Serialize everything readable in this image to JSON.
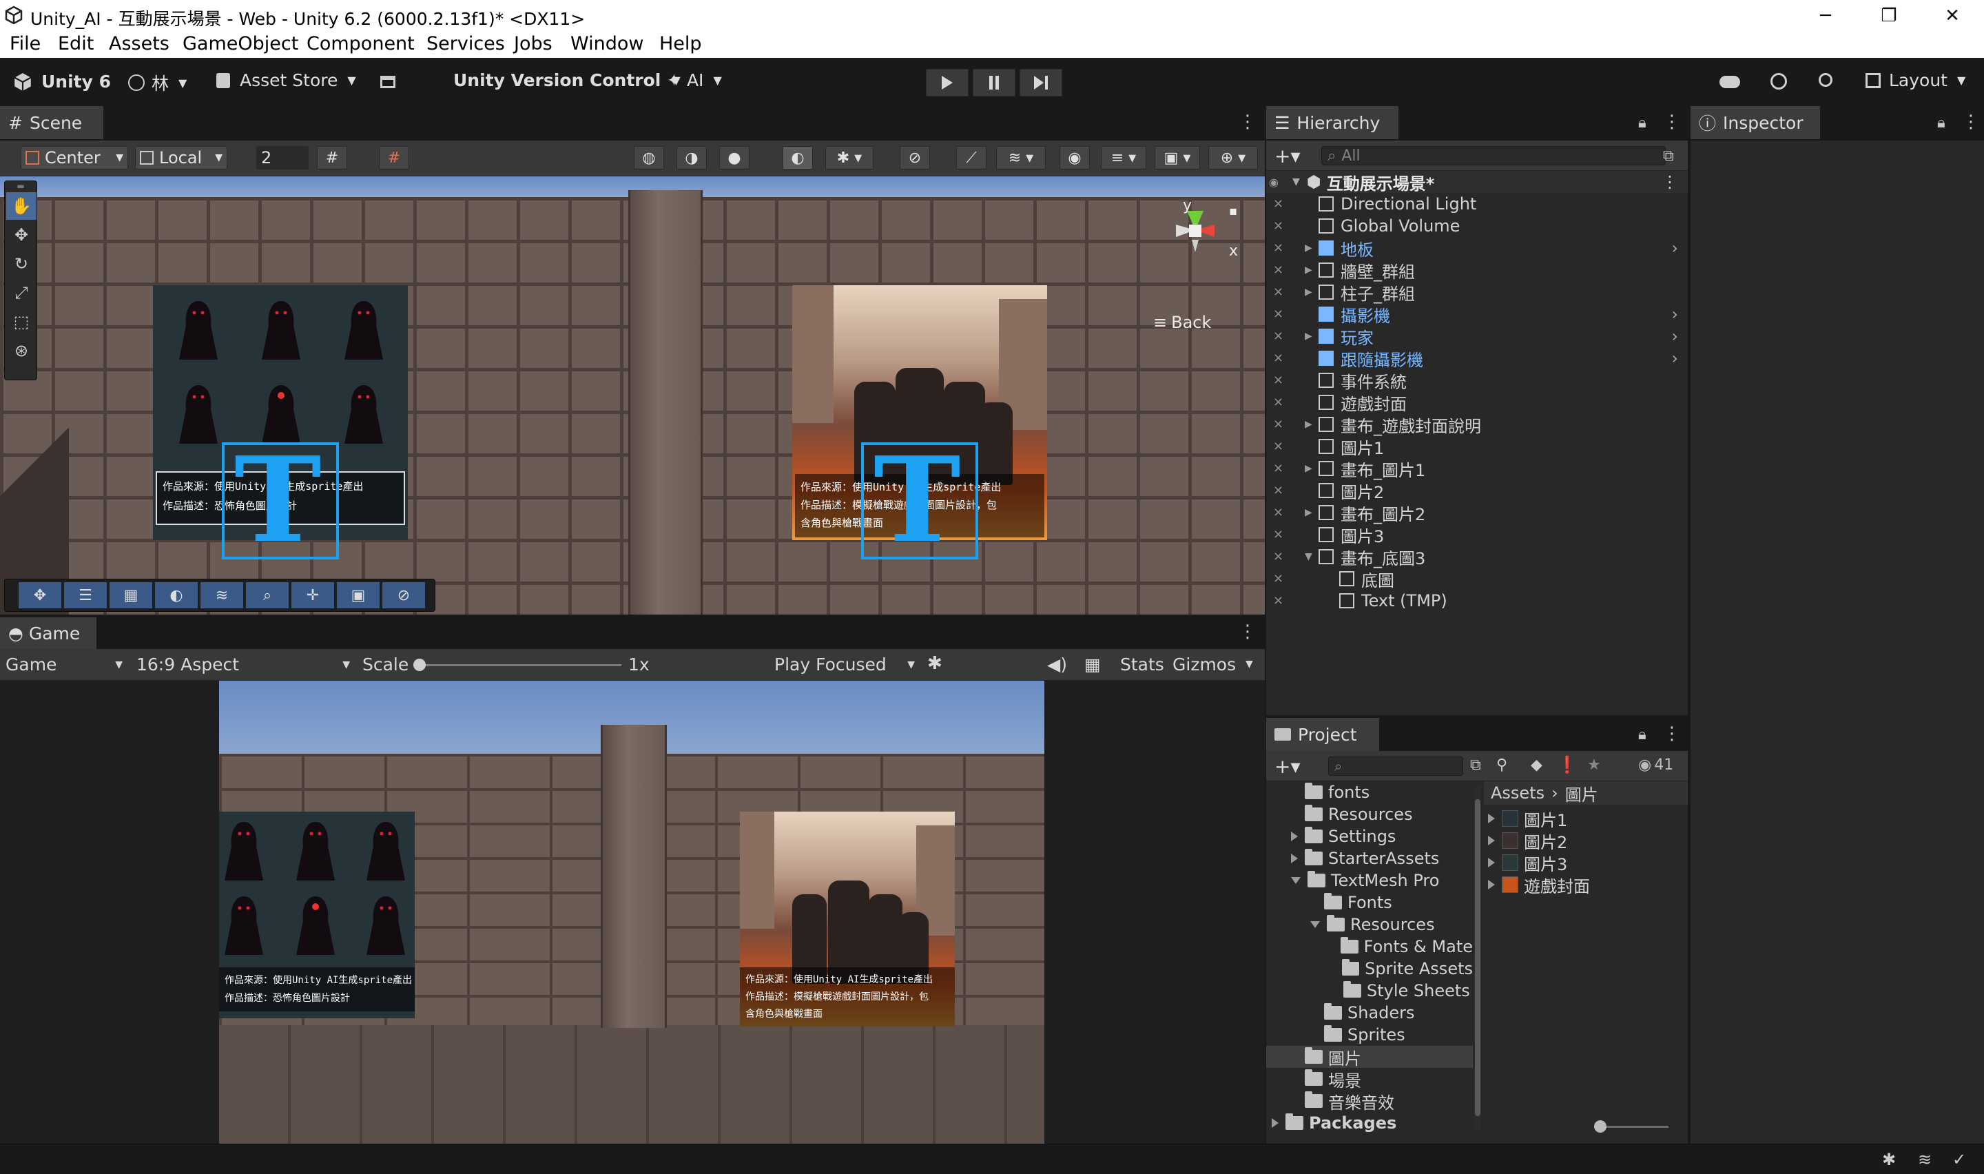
{
  "window": {
    "title": "Unity_AI - 互動展示場景 - Web - Unity 6.2 (6000.2.13f1)* <DX11>",
    "controls": [
      "─",
      "❐",
      "✕"
    ]
  },
  "menu": [
    "File",
    "Edit",
    "Assets",
    "GameObject",
    "Component",
    "Services",
    "Jobs",
    "Window",
    "Help"
  ],
  "toolbar": {
    "unity_label": "Unity 6",
    "account_label": "林",
    "asset_store_label": "Asset Store",
    "vcs_label": "Unity Version Control",
    "ai_label": "AI",
    "layout_label": "Layout"
  },
  "scene": {
    "tab_label": "Scene",
    "pivot_label": "Center",
    "space_label": "Local",
    "grid_value": "2",
    "gizmo_y": "y",
    "gizmo_x": "x",
    "gizmo_back": "Back"
  },
  "game": {
    "tab_label": "Game",
    "display_label": "Game",
    "aspect_label": "16:9 Aspect",
    "scale_label": "Scale",
    "scale_value": "1x",
    "play_mode_label": "Play Focused",
    "stats_label": "Stats",
    "gizmos_label": "Gizmos"
  },
  "cards": {
    "left_line1": "作品來源：使用Unity AI生成sprite產出",
    "left_line2": "作品描述：恐怖角色圖片設計",
    "right_line1": "作品來源：使用Unity AI生成sprite產出",
    "right_line2": "作品描述：模擬槍戰遊戲封面圖片設計，包",
    "right_line3": "含角色與槍戰畫面",
    "t_glyph": "T"
  },
  "hierarchy": {
    "tab_label": "Hierarchy",
    "search_placeholder": "All",
    "scene_name": "互動展示場景*",
    "items": [
      {
        "label": "Directional Light",
        "indent": 1,
        "arrow": "",
        "prefab": false
      },
      {
        "label": "Global Volume",
        "indent": 1,
        "arrow": "",
        "prefab": false
      },
      {
        "label": "地板",
        "indent": 1,
        "arrow": "right",
        "prefab": true
      },
      {
        "label": "牆壁_群組",
        "indent": 1,
        "arrow": "right",
        "prefab": false
      },
      {
        "label": "柱子_群組",
        "indent": 1,
        "arrow": "right",
        "prefab": false
      },
      {
        "label": "攝影機",
        "indent": 1,
        "arrow": "",
        "prefab": true
      },
      {
        "label": "玩家",
        "indent": 1,
        "arrow": "right",
        "prefab": true
      },
      {
        "label": "跟隨攝影機",
        "indent": 1,
        "arrow": "",
        "prefab": true
      },
      {
        "label": "事件系統",
        "indent": 1,
        "arrow": "",
        "prefab": false
      },
      {
        "label": "遊戲封面",
        "indent": 1,
        "arrow": "",
        "prefab": false
      },
      {
        "label": "畫布_遊戲封面說明",
        "indent": 1,
        "arrow": "right",
        "prefab": false
      },
      {
        "label": "圖片1",
        "indent": 1,
        "arrow": "",
        "prefab": false
      },
      {
        "label": "畫布_圖片1",
        "indent": 1,
        "arrow": "right",
        "prefab": false
      },
      {
        "label": "圖片2",
        "indent": 1,
        "arrow": "",
        "prefab": false
      },
      {
        "label": "畫布_圖片2",
        "indent": 1,
        "arrow": "right",
        "prefab": false
      },
      {
        "label": "圖片3",
        "indent": 1,
        "arrow": "",
        "prefab": false
      },
      {
        "label": "畫布_底圖3",
        "indent": 1,
        "arrow": "down",
        "prefab": false
      },
      {
        "label": "底圖",
        "indent": 2,
        "arrow": "",
        "prefab": false
      },
      {
        "label": "Text (TMP)",
        "indent": 2,
        "arrow": "",
        "prefab": false
      }
    ]
  },
  "inspector": {
    "tab_label": "Inspector"
  },
  "project": {
    "tab_label": "Project",
    "count_label": "41",
    "breadcrumb_root": "Assets",
    "breadcrumb_current": "圖片",
    "tree": [
      {
        "label": "fonts",
        "indent": 1,
        "arrow": "",
        "selected": false
      },
      {
        "label": "Resources",
        "indent": 1,
        "arrow": "",
        "selected": false
      },
      {
        "label": "Settings",
        "indent": 1,
        "arrow": "right",
        "selected": false
      },
      {
        "label": "StarterAssets",
        "indent": 1,
        "arrow": "right",
        "selected": false
      },
      {
        "label": "TextMesh Pro",
        "indent": 1,
        "arrow": "down",
        "selected": false
      },
      {
        "label": "Fonts",
        "indent": 2,
        "arrow": "",
        "selected": false
      },
      {
        "label": "Resources",
        "indent": 2,
        "arrow": "down",
        "selected": false
      },
      {
        "label": "Fonts & Mate",
        "indent": 3,
        "arrow": "",
        "selected": false
      },
      {
        "label": "Sprite Assets",
        "indent": 3,
        "arrow": "",
        "selected": false
      },
      {
        "label": "Style Sheets",
        "indent": 3,
        "arrow": "",
        "selected": false
      },
      {
        "label": "Shaders",
        "indent": 2,
        "arrow": "",
        "selected": false
      },
      {
        "label": "Sprites",
        "indent": 2,
        "arrow": "",
        "selected": false
      },
      {
        "label": "圖片",
        "indent": 1,
        "arrow": "",
        "selected": true
      },
      {
        "label": "場景",
        "indent": 1,
        "arrow": "",
        "selected": false
      },
      {
        "label": "音樂音效",
        "indent": 1,
        "arrow": "",
        "selected": false
      },
      {
        "label": "Packages",
        "indent": 0,
        "arrow": "right",
        "selected": false
      }
    ],
    "assets": [
      "圖片1",
      "圖片2",
      "圖片3",
      "遊戲封面"
    ]
  },
  "colors": {
    "accent_blue": "#1da1f2",
    "prefab_blue": "#7bb7ff",
    "panel_bg": "#383838",
    "dark_bg": "#191919"
  }
}
